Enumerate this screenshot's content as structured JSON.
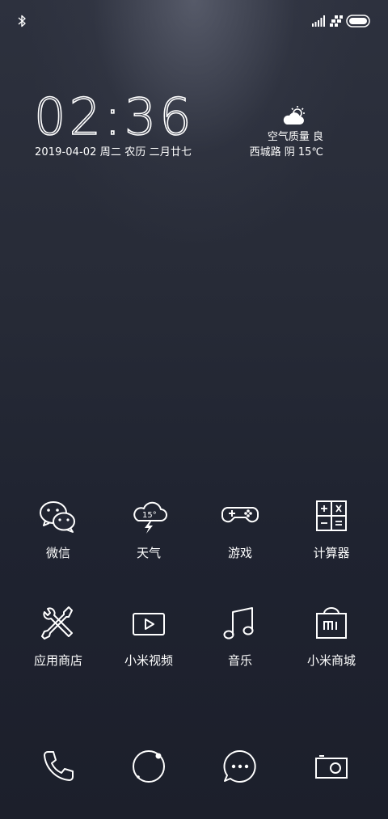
{
  "status_bar": {
    "icons": [
      "bluetooth-icon",
      "signal-icon",
      "network-icon",
      "battery-icon"
    ]
  },
  "clock": {
    "time": "02:36",
    "date": "2019-04-02 周二 农历 二月廿七"
  },
  "weather": {
    "icon": "partly-cloudy-icon",
    "air_quality": "空气质量 良",
    "location": "西城路 阴 15℃",
    "icon_temp": "15°"
  },
  "apps": [
    {
      "label": "微信",
      "icon": "wechat-icon"
    },
    {
      "label": "天气",
      "icon": "weather-app-icon"
    },
    {
      "label": "游戏",
      "icon": "gamepad-icon"
    },
    {
      "label": "计算器",
      "icon": "calculator-icon"
    },
    {
      "label": "应用商店",
      "icon": "tools-icon"
    },
    {
      "label": "小米视频",
      "icon": "video-play-icon"
    },
    {
      "label": "音乐",
      "icon": "music-note-icon"
    },
    {
      "label": "小米商城",
      "icon": "mi-store-icon"
    }
  ],
  "dock": [
    {
      "icon": "phone-icon"
    },
    {
      "icon": "browser-orbit-icon"
    },
    {
      "icon": "messages-icon"
    },
    {
      "icon": "camera-icon"
    }
  ]
}
